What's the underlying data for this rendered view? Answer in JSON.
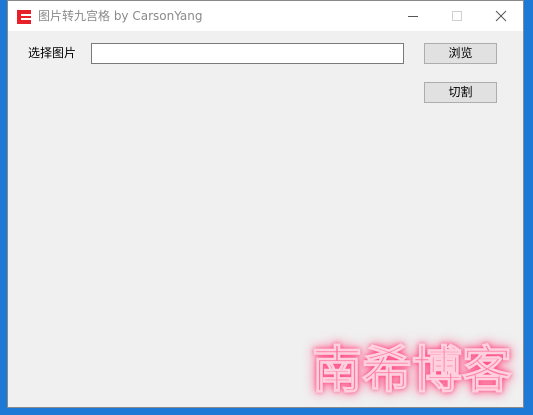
{
  "window": {
    "title": "图片转九宫格 by CarsonYang"
  },
  "form": {
    "select_label": "选择图片",
    "path_value": "",
    "browse_label": "浏览",
    "cut_label": "切割"
  },
  "watermark": {
    "text": "南希博客"
  },
  "colors": {
    "app_icon": "#e8202a",
    "desktop": "#1d78d6",
    "watermark": "#ff7aa0"
  },
  "icons": [
    "app-logo-icon",
    "minimize-icon",
    "maximize-icon",
    "close-icon"
  ]
}
